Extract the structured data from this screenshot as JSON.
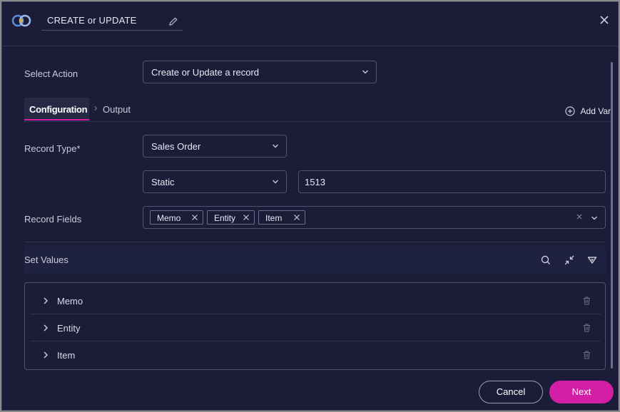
{
  "header": {
    "title": "CREATE or UPDATE",
    "icons": {
      "logo": "app-logo",
      "edit": "pencil-icon",
      "close": "close-icon"
    }
  },
  "select_action": {
    "label": "Select Action",
    "value": "Create or Update a record"
  },
  "tabs": [
    {
      "label": "Configuration",
      "active": true
    },
    {
      "label": "Output",
      "active": false
    }
  ],
  "add_var": {
    "label": "Add Var",
    "icon": "plus-circle-icon"
  },
  "record_type": {
    "label": "Record Type*",
    "value": "Sales Order"
  },
  "id_source": {
    "value": "Static",
    "id_value": "1513"
  },
  "record_fields": {
    "label": "Record Fields",
    "chips": [
      "Memo",
      "Entity",
      "Item"
    ]
  },
  "set_values": {
    "title": "Set Values",
    "icons": [
      "search-icon",
      "collapse-icon",
      "filter-icon"
    ],
    "rows": [
      "Memo",
      "Entity",
      "Item"
    ]
  },
  "footer": {
    "cancel_label": "Cancel",
    "next_label": "Next"
  },
  "colors": {
    "background": "#1b1d38",
    "accent": "#d21fa6",
    "border": "#4e5170"
  }
}
